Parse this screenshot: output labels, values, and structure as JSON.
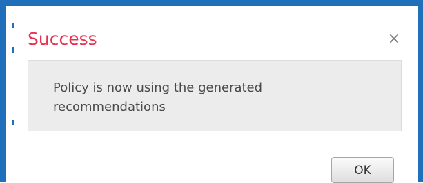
{
  "dialog": {
    "title": "Success",
    "close_glyph": "×",
    "close_icon": "close-icon",
    "message": "Policy is now using the generated recommendations",
    "ok_label": "OK"
  },
  "colors": {
    "frame_border": "#1f6fba",
    "title": "#e8304f",
    "message_background": "#ececec"
  }
}
